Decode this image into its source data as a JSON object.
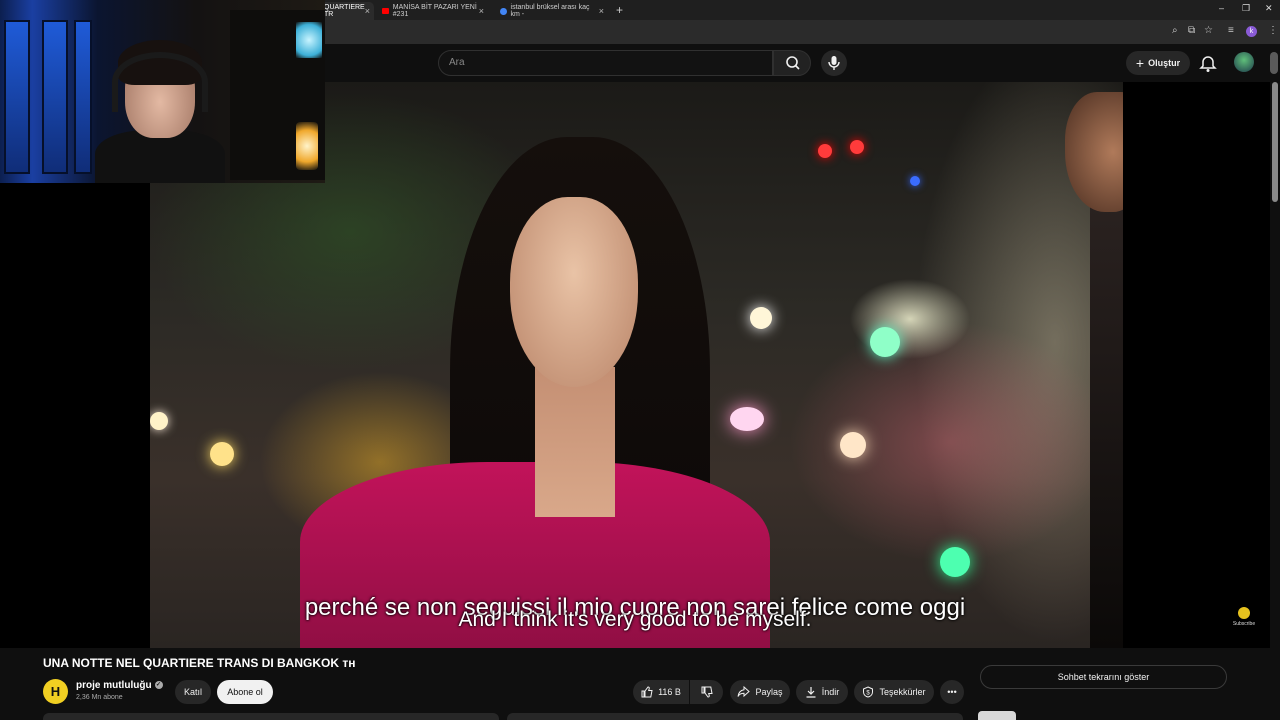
{
  "browser": {
    "tabs": [
      {
        "label": "QUARTIERE TR",
        "color": "#ff0000"
      },
      {
        "label": "MANİSA BİT PAZARI YENİ #231",
        "color": "#ff0000"
      },
      {
        "label": "istanbul brüksel arası kaç km -",
        "color": "#4285f4"
      }
    ],
    "profile_initial": "k"
  },
  "header": {
    "search_placeholder": "Ara",
    "create_label": "Oluştur"
  },
  "video": {
    "caption_italian": "perché se non seguissi il mio cuore non sarei felice come oggi",
    "caption_english": "And I think it's very good to be myself.",
    "watermark": "Subscribe"
  },
  "info": {
    "title": "UNA NOTTE NEL QUARTIERE TRANS DI BANGKOK ᴛʜ",
    "channel_name": "proje mutluluğu",
    "channel_avatar_letter": "H",
    "subscribers": "2,36 Mn abone",
    "join_label": "Katıl",
    "subscribe_label": "Abone ol",
    "likes": "116 B",
    "share_label": "Paylaş",
    "download_label": "İndir",
    "thanks_label": "Teşekkürler",
    "more_label": "•••",
    "chat_replay_label": "Sohbet tekrarını göster"
  },
  "colors": {
    "background": "#0f0f0f",
    "pill": "#272727",
    "subscribe_bg": "#f1f1f1",
    "accent_red": "#ff0000"
  }
}
